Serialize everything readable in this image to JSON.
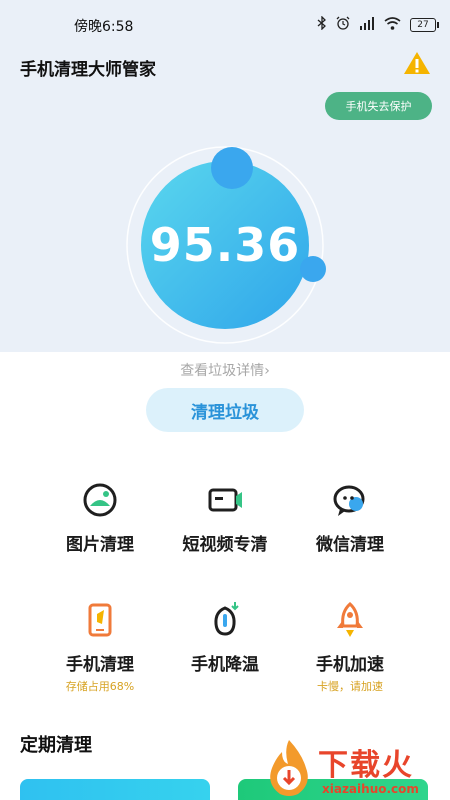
{
  "status_bar": {
    "time": "傍晚6:58",
    "battery": "27"
  },
  "header": {
    "title": "手机清理大师管家",
    "protect_button": "手机失去保护"
  },
  "gauge": {
    "score": "95.36"
  },
  "detail_link": "查看垃圾详情",
  "clean_button": "清理垃圾",
  "tools": [
    {
      "label": "图片清理",
      "sub": ""
    },
    {
      "label": "短视频专清",
      "sub": ""
    },
    {
      "label": "微信清理",
      "sub": ""
    },
    {
      "label": "手机清理",
      "sub": "存储占用68%"
    },
    {
      "label": "手机降温",
      "sub": ""
    },
    {
      "label": "手机加速",
      "sub": "卡慢，请加速"
    }
  ],
  "section": {
    "title": "定期清理"
  },
  "watermark": {
    "name": "下载火",
    "url": "xiazaihuo.com"
  },
  "colors": {
    "accent": "#2a93d9",
    "protect": "#4db386",
    "warning": "#f5b400",
    "sub_text": "#d7a222"
  }
}
